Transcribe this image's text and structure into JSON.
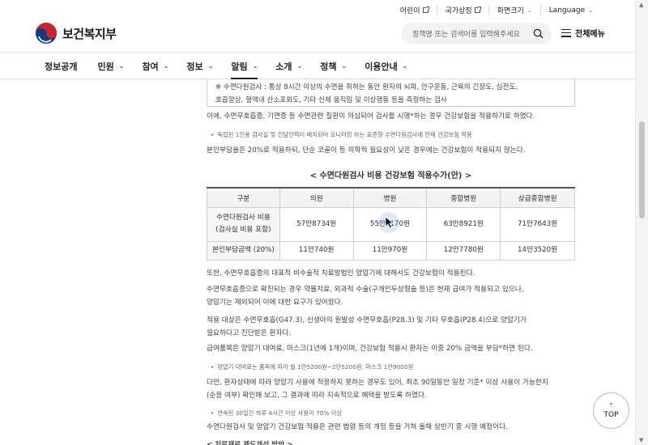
{
  "utility": {
    "items": [
      {
        "label": "어린이"
      },
      {
        "label": "국가상징"
      },
      {
        "label": "화면크기"
      },
      {
        "label": "Language"
      }
    ]
  },
  "header": {
    "logo_text": "보건복지부",
    "search_placeholder": "정책명 또는 검색어를 입력해주세요",
    "all_menu": "전체메뉴"
  },
  "gnb": {
    "items": [
      {
        "label": "정보공개"
      },
      {
        "label": "민원"
      },
      {
        "label": "참여"
      },
      {
        "label": "정보"
      },
      {
        "label": "알림"
      },
      {
        "label": "소개"
      },
      {
        "label": "정책"
      },
      {
        "label": "이용안내"
      }
    ],
    "active": "알림"
  },
  "content": {
    "note_line1": "※ 수면다원검사 : 통상 8시간 이상의 수면을 취하는 동안 환자의 뇌파, 안구운동, 근육의 긴장도, 심전도,",
    "note_line2": "호흡양상, 혈액내 산소포화도, 기타 신체 움직임 및 이상행동 등을 측정하는 검사",
    "p1": "이에, 수면무호흡증, 기면증 등 수면관련 질환이 의심되어 검사를 시행*하는 경우 건강보험을 적용하기로 하였다.",
    "s1": "독립된 1인용 검사실 및 전담인력이 배치되어 모니터링 하는 표준형 수면다원검사에 한해 건강보험 적용",
    "p2": "본인부담율은 20%로 적용하되, 단순 코골이 등 의학적 필요성이 낮은 경우에는 건강보험이 적용되지 않는다.",
    "table_title": "< 수면다원검사 비용 건강보험 적용수가(안) >",
    "table": {
      "headers": [
        "구분",
        "의원",
        "병원",
        "종합병원",
        "상급종합병원"
      ],
      "row1_label_a": "수면다원검사 비용",
      "row1_label_b": "(검사실 비용 포함)",
      "row1": [
        "57만8734원",
        "55만9170원",
        "63만8921원",
        "71만7643원"
      ],
      "row2_label": "본인부담금액 (20%)",
      "row2": [
        "11만740원",
        "11만970원",
        "12만7780원",
        "14만3520원"
      ]
    },
    "p3": "또한, 수면무호흡증의 대표적 비수술적 치료방법인 양압기에 대해서도 건강보험이 적용된다.",
    "p4a": "수면무호흡증으로 확진되는 경우 약물치료, 외과적 수술(구개인두성형술 등)은 현재 급여가 적용되고 있으나,",
    "p4b": "양압기는 제외되어 이에 대한 요구가 있어왔다.",
    "p5a": "적용 대상은 수면무호흡(G47.3), 신생아의 원발성 수면무호흡(P28.3) 및 기타 무호흡(P28.4)으로 양압기가",
    "p5b": "필요하다고 진단받은 환자다.",
    "p6": "급여품목은 양압기 대여료, 마스크(1년에 1개)이며, 건강보험 적용시 환자는 이중 20% 금액을 부담*하면 된다.",
    "s2": "양압기 대여료는 품목에 따라 월 1만5200원~2만5200원, 마스크 1만9000원",
    "p7a": "다만, 환자상태에 따라 양압기 사용에 적응하지 못하는 경우도 있어, 최초 90일동안 일정 기준* 이상 사용이 가능한지",
    "p7b": "(순응 여부) 확인해 보고, 그 결과에 따라 지속적으로 혜택을 받도록 하였다.",
    "s3": "연속된 30일간 하루 4시간 이상 사용이 70% 이상",
    "p8": "수면다원검사 및 양압기 건강보험 적용은 관련 법령 등의 개정 등을 거쳐 올해 상반기 중 시행 예정이다.",
    "p9": "< 치료재료 제도개선 방안 >"
  },
  "top_button": "TOP",
  "colors": {
    "logo_red": "#c9252c",
    "logo_blue": "#0f3c85",
    "table_header_bg": "#f3f3f3"
  }
}
